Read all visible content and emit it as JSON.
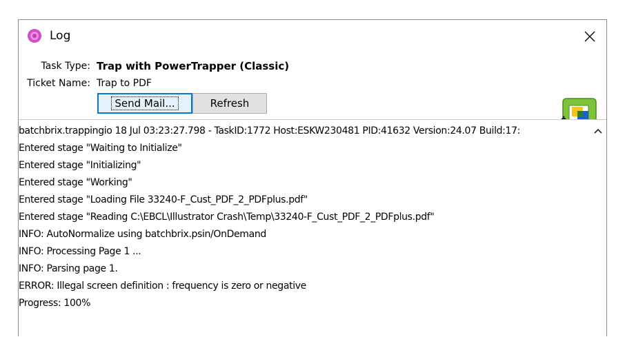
{
  "window": {
    "title": "Log",
    "close_glyph": "✕",
    "app_icon": "log-app-icon"
  },
  "fields": {
    "task_type_label": "Task Type:",
    "task_type_value": "Trap with PowerTrapper (Classic)",
    "ticket_name_label": "Ticket Name:",
    "ticket_name_value": "Trap to PDF"
  },
  "buttons": {
    "send_mail_label": "Send Mail...",
    "refresh_label": "Refresh"
  },
  "badge": {
    "icon": "trapping-settings-icon"
  },
  "log": {
    "lines": [
      "batchbrix.trappingio 18 Jul 03:23:27.798 - TaskID:1772 Host:ESKW230481 PID:41632 Version:24.07 Build:17:",
      "Entered stage \"Waiting to Initialize\"",
      "Entered stage \"Initializing\"",
      "Entered stage \"Working\"",
      "Entered stage \"Loading File 33240-F_Cust_PDF_2_PDFplus.pdf\"",
      "Entered stage \"Reading C:\\EBCL\\Illustrator Crash\\Temp\\33240-F_Cust_PDF_2_PDFplus.pdf\"",
      "INFO: AutoNormalize using batchbrix.psin/OnDemand",
      "INFO: Processing Page 1 ...",
      "INFO: Parsing page 1.",
      "ERROR: Illegal screen definition : frequency is zero or negative",
      "Progress: 100%"
    ]
  },
  "colors": {
    "window_bg": "#f0f0f0",
    "content_bg": "#ffffff",
    "focus_accent": "#0078d7",
    "icon_pink": "#d04fc6"
  }
}
